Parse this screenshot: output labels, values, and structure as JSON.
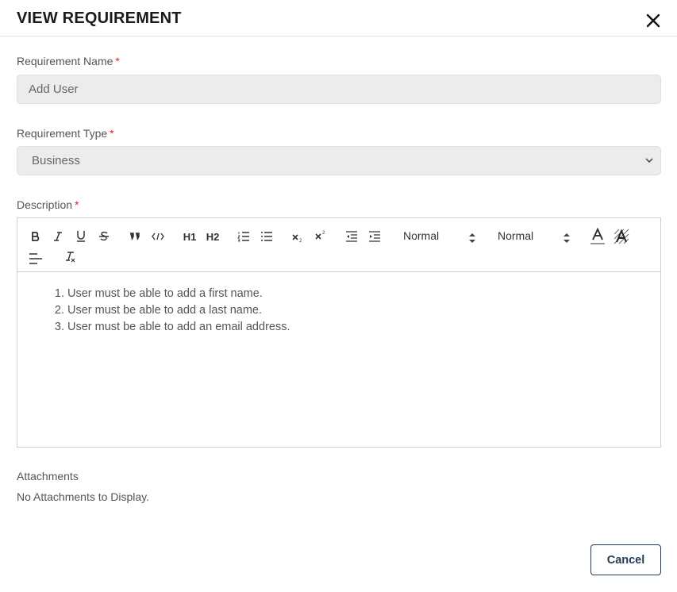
{
  "dialog": {
    "title": "VIEW REQUIREMENT",
    "close_icon": "close-icon"
  },
  "form": {
    "name_label": "Requirement Name",
    "name_value": "Add User",
    "type_label": "Requirement Type",
    "type_value": "Business",
    "description_label": "Description",
    "required_marker": "*"
  },
  "editor": {
    "toolbar_icons": [
      "bold-icon",
      "italic-icon",
      "underline-icon",
      "strike-icon",
      "blockquote-icon",
      "code-icon",
      "h1-icon",
      "h2-icon",
      "ordered-list-icon",
      "bullet-list-icon",
      "subscript-icon",
      "superscript-icon",
      "outdent-icon",
      "indent-icon",
      "text-color-icon",
      "background-color-icon",
      "align-icon",
      "clear-format-icon"
    ],
    "h1": "H1",
    "h2": "H2",
    "picker1": "Normal",
    "picker2": "Normal",
    "items": [
      "User must be able to add a first name.",
      "User must be able to add a last name.",
      "User must be able to add an email address."
    ]
  },
  "attachments": {
    "label": "Attachments",
    "empty_text": "No Attachments to Display."
  },
  "footer": {
    "cancel_label": "Cancel"
  },
  "colors": {
    "required": "#e02424",
    "button_border": "#1f3b57",
    "field_bg": "#ececec"
  }
}
